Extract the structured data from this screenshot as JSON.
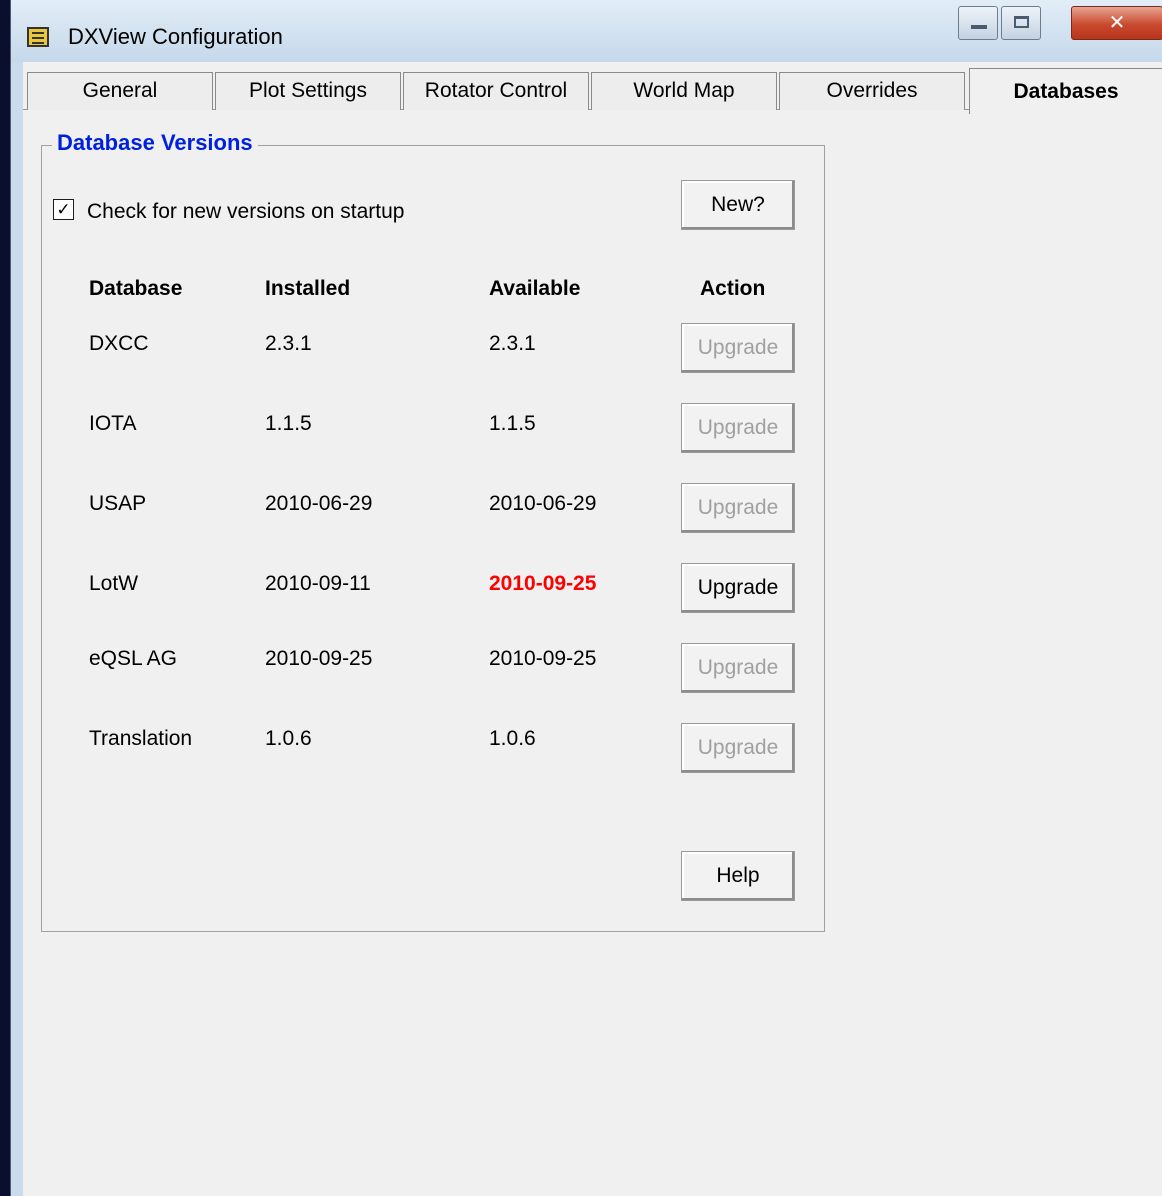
{
  "window": {
    "title": "DXView Configuration"
  },
  "tabs": [
    {
      "label": "General"
    },
    {
      "label": "Plot Settings"
    },
    {
      "label": "Rotator Control"
    },
    {
      "label": "World Map"
    },
    {
      "label": "Overrides"
    },
    {
      "label": "Databases"
    }
  ],
  "active_tab": "Databases",
  "group": {
    "title": "Database Versions",
    "check_label": "Check for new versions on startup",
    "checked": true,
    "check_mark": "✓",
    "new_button": "New?",
    "help_button": "Help"
  },
  "table": {
    "headers": {
      "database": "Database",
      "installed": "Installed",
      "available": "Available",
      "action": "Action"
    },
    "rows": [
      {
        "name": "DXCC",
        "installed": "2.3.1",
        "available": "2.3.1",
        "action": "Upgrade",
        "enabled": false
      },
      {
        "name": "IOTA",
        "installed": "1.1.5",
        "available": "1.1.5",
        "action": "Upgrade",
        "enabled": false
      },
      {
        "name": "USAP",
        "installed": "2010-06-29",
        "available": "2010-06-29",
        "action": "Upgrade",
        "enabled": false
      },
      {
        "name": "LotW",
        "installed": "2010-09-11",
        "available": "2010-09-25",
        "action": "Upgrade",
        "enabled": true
      },
      {
        "name": "eQSL AG",
        "installed": "2010-09-25",
        "available": "2010-09-25",
        "action": "Upgrade",
        "enabled": false
      },
      {
        "name": "Translation",
        "installed": "1.0.6",
        "available": "1.0.6",
        "action": "Upgrade",
        "enabled": false
      }
    ]
  },
  "colors": {
    "group_title": "#0020e0",
    "newer_version": "#ff0000",
    "disabled_text": "#a0a0a0"
  },
  "icons": {
    "app": "app-icon",
    "minimize": "minimize-icon",
    "maximize": "maximize-icon",
    "close": "close-icon"
  }
}
